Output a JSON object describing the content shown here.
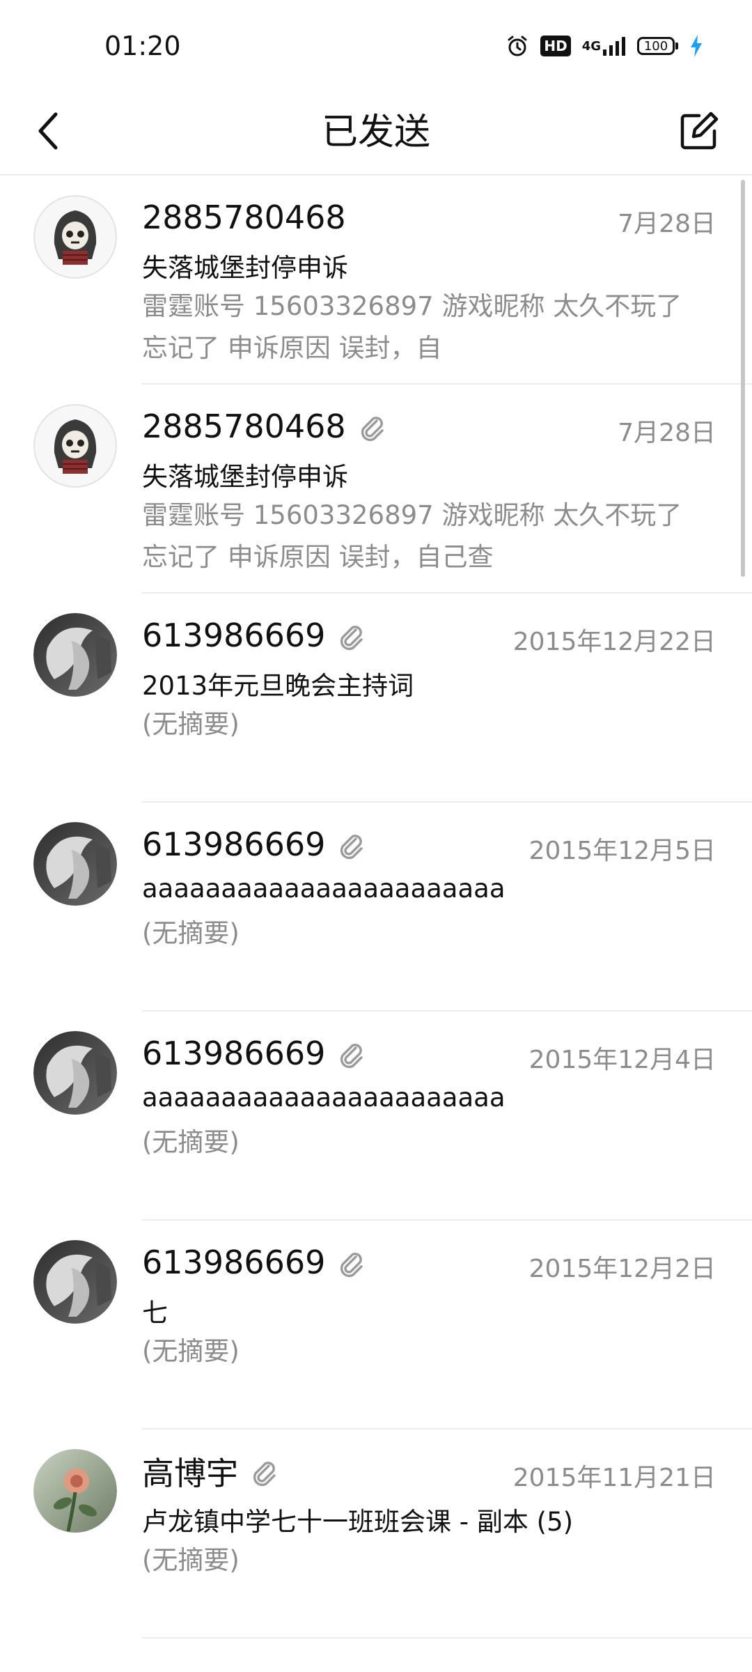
{
  "status_bar": {
    "time": "01:20",
    "icons": [
      "alarm-icon",
      "hd-icon",
      "signal-icon",
      "battery-icon",
      "charging-icon"
    ],
    "hd_label": "HD",
    "network_label": "4G",
    "battery_level": "100"
  },
  "header": {
    "title": "已发送",
    "back_icon": "chevron-left-icon",
    "compose_icon": "compose-icon"
  },
  "colors": {
    "primary_text": "#111111",
    "secondary_text": "#8c8c8c",
    "divider": "#ececec",
    "charging": "#1aa0ff"
  },
  "messages": [
    {
      "sender": "2885780468",
      "has_attachment": false,
      "date": "7月28日",
      "subject": "失落城堡封停申诉",
      "summary": "雷霆账号 15603326897 游戏昵称   太久不玩了忘记了 申诉原因   误封，自",
      "avatar": "skull-hood"
    },
    {
      "sender": "2885780468",
      "has_attachment": true,
      "date": "7月28日",
      "subject": "失落城堡封停申诉",
      "summary": "雷霆账号 15603326897 游戏昵称   太久不玩了忘记了 申诉原因   误封，自己查",
      "avatar": "skull-hood"
    },
    {
      "sender": "613986669",
      "has_attachment": true,
      "date": "2015年12月22日",
      "subject": "2013年元旦晚会主持词",
      "summary": "(无摘要)",
      "avatar": "anime-gray"
    },
    {
      "sender": "613986669",
      "has_attachment": true,
      "date": "2015年12月5日",
      "subject": "aaaaaaaaaaaaaaaaaaaaaaa",
      "summary": "(无摘要)",
      "avatar": "anime-gray"
    },
    {
      "sender": "613986669",
      "has_attachment": true,
      "date": "2015年12月4日",
      "subject": "aaaaaaaaaaaaaaaaaaaaaaa",
      "summary": "(无摘要)",
      "avatar": "anime-gray"
    },
    {
      "sender": "613986669",
      "has_attachment": true,
      "date": "2015年12月2日",
      "subject": "七",
      "summary": "(无摘要)",
      "avatar": "anime-gray"
    },
    {
      "sender": "高博宇",
      "has_attachment": true,
      "date": "2015年11月21日",
      "subject": "卢龙镇中学七十一班班会课 - 副本 (5)",
      "summary": "(无摘要)",
      "avatar": "rose-photo"
    }
  ]
}
